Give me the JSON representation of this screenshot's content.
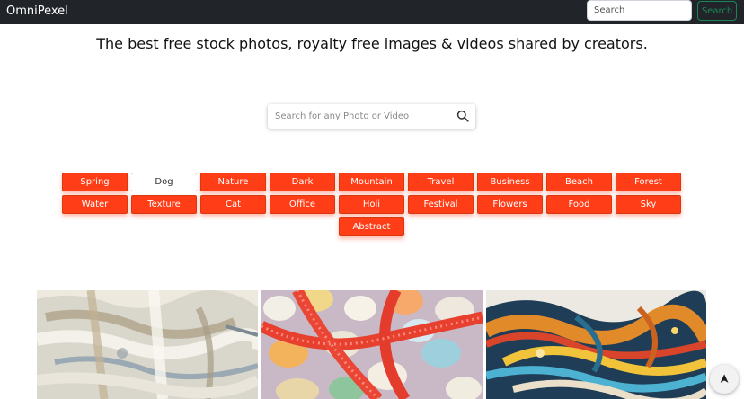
{
  "navbar": {
    "brand": "OmniPexel",
    "search_placeholder": "Search",
    "search_button": "Search"
  },
  "headline": "The best free stock photos, royalty free images & videos shared by creators.",
  "hero_search": {
    "placeholder": "Search for any Photo or Video",
    "icon": "search-icon"
  },
  "categories": [
    {
      "label": "Spring",
      "active": false
    },
    {
      "label": "Dog",
      "active": true
    },
    {
      "label": "Nature",
      "active": false
    },
    {
      "label": "Dark",
      "active": false
    },
    {
      "label": "Mountain",
      "active": false
    },
    {
      "label": "Travel",
      "active": false
    },
    {
      "label": "Business",
      "active": false
    },
    {
      "label": "Beach",
      "active": false
    },
    {
      "label": "Forest",
      "active": false
    },
    {
      "label": "Water",
      "active": false
    },
    {
      "label": "Texture",
      "active": false
    },
    {
      "label": "Cat",
      "active": false
    },
    {
      "label": "Office",
      "active": false
    },
    {
      "label": "Holi",
      "active": false
    },
    {
      "label": "Festival",
      "active": false
    },
    {
      "label": "Flowers",
      "active": false
    },
    {
      "label": "Food",
      "active": false
    },
    {
      "label": "Sky",
      "active": false
    },
    {
      "label": "Abstract",
      "active": false
    }
  ],
  "photos": [
    {
      "subject": "paint-texture"
    },
    {
      "subject": "candy"
    },
    {
      "subject": "marbled-paint"
    }
  ],
  "scroll_top": {
    "glyph": "➤",
    "icon": "arrow-up-icon"
  },
  "colors": {
    "navbar": "#212529",
    "category_button": "#ff3d17",
    "active_underline": "#d81b60",
    "nav_button": "#198754"
  }
}
